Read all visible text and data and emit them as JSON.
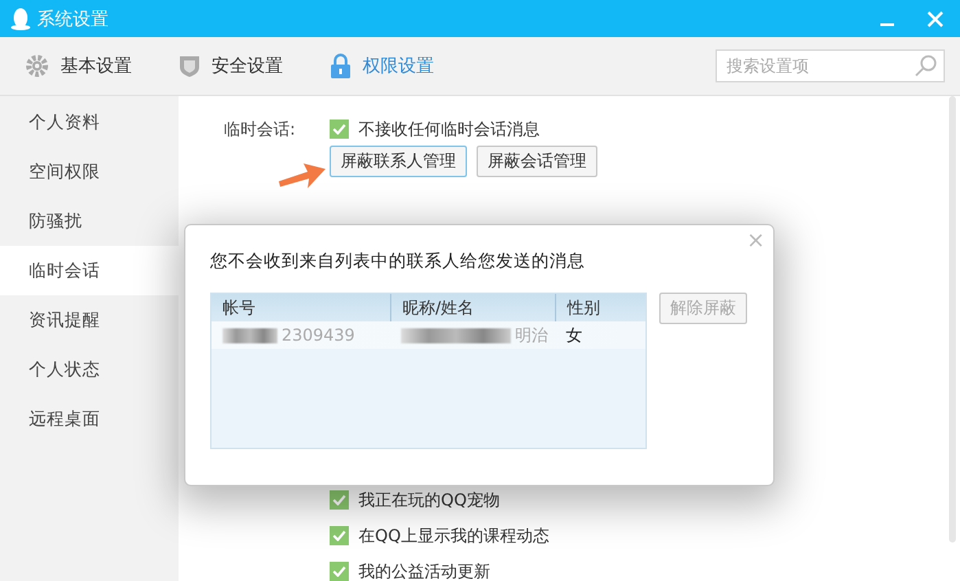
{
  "window": {
    "title": "系统设置"
  },
  "toolbar_tabs": [
    {
      "label": "基本设置",
      "kind": "gear",
      "selected": false
    },
    {
      "label": "安全设置",
      "kind": "shield",
      "selected": false
    },
    {
      "label": "权限设置",
      "kind": "lock",
      "selected": true
    }
  ],
  "search": {
    "placeholder": "搜索设置项"
  },
  "sidebar": {
    "items": [
      {
        "label": "个人资料",
        "selected": false
      },
      {
        "label": "空间权限",
        "selected": false
      },
      {
        "label": "防骚扰",
        "selected": false
      },
      {
        "label": "临时会话",
        "selected": true
      },
      {
        "label": "资讯提醒",
        "selected": false
      },
      {
        "label": "个人状态",
        "selected": false
      },
      {
        "label": "远程桌面",
        "selected": false
      }
    ]
  },
  "sections": [
    {
      "label": "临时会话:",
      "options": [
        {
          "label": "不接收任何临时会话消息",
          "checked": true
        }
      ],
      "buttons": [
        "屏蔽联系人管理",
        "屏蔽会话管理"
      ]
    }
  ],
  "more_options": [
    {
      "label": "我正在玩的QQ宠物",
      "checked": true
    },
    {
      "label": "在QQ上显示我的课程动态",
      "checked": true
    },
    {
      "label": "我的公益活动更新",
      "checked": true
    }
  ],
  "dialog": {
    "close": "×",
    "message": "您不会收到来自列表中的联系人给您发送的消息",
    "columns": [
      "帐号",
      "昵称/姓名",
      "性别"
    ],
    "rows": [
      [
        "2309439",
        "明治",
        "女"
      ]
    ],
    "button": {
      "label": "解除屏蔽",
      "disabled": true
    }
  }
}
